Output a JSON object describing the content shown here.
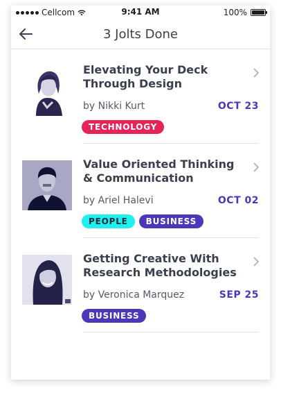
{
  "status_bar": {
    "carrier": "Cellcom",
    "time": "9:41 AM",
    "battery": "100%"
  },
  "nav": {
    "title": "3 Jolts Done"
  },
  "colors": {
    "accent": "#4a38b8",
    "technology": "#e6245a",
    "business": "#4a38b8",
    "people": "#1df0ee"
  },
  "items": [
    {
      "title": "Elevating Your Deck Through Design",
      "author": "by Nikki Kurt",
      "date": "OCT 23",
      "tags": [
        "TECHNOLOGY"
      ]
    },
    {
      "title": "Value Oriented Thinking & Communication",
      "author": "by Ariel Halevi",
      "date": "OCT 02",
      "tags": [
        "PEOPLE",
        "BUSINESS"
      ]
    },
    {
      "title": "Getting Creative With Research Methodologies",
      "author": "by Veronica Marquez",
      "date": "SEP 25",
      "tags": [
        "BUSINESS"
      ]
    }
  ]
}
